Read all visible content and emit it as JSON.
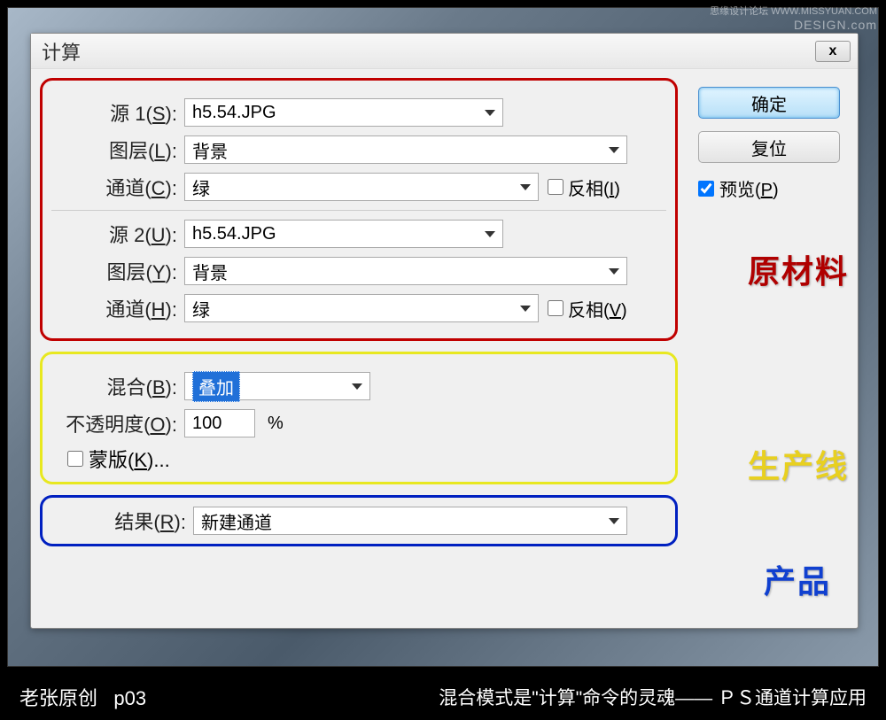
{
  "watermark": {
    "line1": "思缘设计论坛  WWW.MISSYUAN.COM",
    "line2": "DESIGN.com"
  },
  "dialog": {
    "title": "计算",
    "close": "x",
    "source1": {
      "label": "源 1(S):",
      "value": "h5.54.JPG",
      "layer_label": "图层(L):",
      "layer_value": "背景",
      "channel_label": "通道(C):",
      "channel_value": "绿",
      "invert_label": "反相(I)"
    },
    "source2": {
      "label": "源 2(U):",
      "value": "h5.54.JPG",
      "layer_label": "图层(Y):",
      "layer_value": "背景",
      "channel_label": "通道(H):",
      "channel_value": "绿",
      "invert_label": "反相(V)"
    },
    "blend": {
      "label": "混合(B):",
      "value": "叠加",
      "opacity_label": "不透明度(O):",
      "opacity_value": "100",
      "opacity_unit": "%",
      "mask_label": "蒙版(K)..."
    },
    "result": {
      "label": "结果(R):",
      "value": "新建通道"
    },
    "buttons": {
      "ok": "确定",
      "cancel": "复位"
    },
    "preview_label": "预览(P)"
  },
  "annotations": {
    "raw_material": "原材料",
    "production_line": "生产线",
    "product": "产品"
  },
  "footer": {
    "left_author": "老张原创",
    "left_page": "p03",
    "right": "混合模式是\"计算\"命令的灵魂—— ＰＳ通道计算应用"
  }
}
